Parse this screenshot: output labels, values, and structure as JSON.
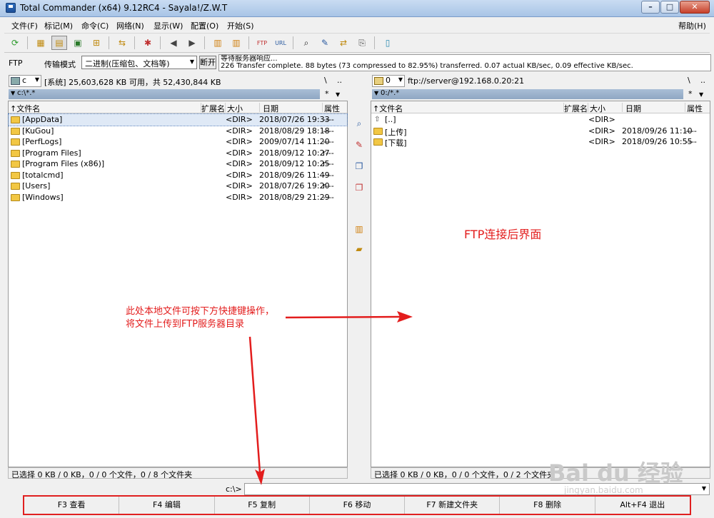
{
  "window": {
    "title": "Total Commander (x64) 9.12RC4 - Sayala!/Z.W.T",
    "controls": [
      "–",
      "□",
      "✕"
    ]
  },
  "menu": {
    "items": [
      "文件(F)",
      "标记(M)",
      "命令(C)",
      "网络(N)",
      "显示(W)",
      "配置(O)",
      "开始(S)"
    ],
    "help": "帮助(H)"
  },
  "ftpbar": {
    "label": "FTP",
    "mode_label": "传输模式",
    "mode_value": "二进制(压缩包、文档等)",
    "disconnect": "断开",
    "log_line1": "等待服务器响应...",
    "log_line2": "226 Transfer complete. 88 bytes (73 compressed to 82.95%) transferred. 0.07 actual KB/sec, 0.09 effective KB/sec."
  },
  "left": {
    "drive": "c",
    "info": "[系统]  25,603,628 KB 可用，共 52,430,844 KB",
    "path": "c:\\*.*",
    "columns": {
      "name": "文件名",
      "ext": "扩展名",
      "size": "大小",
      "date": "日期",
      "attr": "属性"
    },
    "files": [
      {
        "name": "[AppData]",
        "size": "<DIR>",
        "date": "2018/07/26 19:33",
        "attr": "----"
      },
      {
        "name": "[KuGou]",
        "size": "<DIR>",
        "date": "2018/08/29 18:18",
        "attr": "----"
      },
      {
        "name": "[PerfLogs]",
        "size": "<DIR>",
        "date": "2009/07/14 11:20",
        "attr": "----"
      },
      {
        "name": "[Program Files]",
        "size": "<DIR>",
        "date": "2018/09/12 10:27",
        "attr": "r---"
      },
      {
        "name": "[Program Files (x86)]",
        "size": "<DIR>",
        "date": "2018/09/12 10:25",
        "attr": "r---"
      },
      {
        "name": "[totalcmd]",
        "size": "<DIR>",
        "date": "2018/09/26 11:49",
        "attr": "----"
      },
      {
        "name": "[Users]",
        "size": "<DIR>",
        "date": "2018/07/26 19:20",
        "attr": "r---"
      },
      {
        "name": "[Windows]",
        "size": "<DIR>",
        "date": "2018/08/29 21:29",
        "attr": "----"
      }
    ],
    "status": "已选择 0 KB / 0 KB，0 / 0 个文件，0 / 8 个文件夹"
  },
  "right": {
    "drive": "0",
    "info": "ftp://server@192.168.0.20:21",
    "path": "0:/*.*",
    "columns": {
      "name": "文件名",
      "ext": "扩展名",
      "size": "大小",
      "date": "日期",
      "attr": "属性"
    },
    "files": [
      {
        "name": "[..]",
        "size": "<DIR>",
        "date": "",
        "attr": ""
      },
      {
        "name": "[上传]",
        "size": "<DIR>",
        "date": "2018/09/26 11:10",
        "attr": "----"
      },
      {
        "name": "[下载]",
        "size": "<DIR>",
        "date": "2018/09/26 10:55",
        "attr": "----"
      }
    ],
    "status": "已选择 0 KB / 0 KB，0 / 0 个文件，0 / 2 个文件夹"
  },
  "panel_nav": {
    "root": "\\",
    "parent": "..",
    "filter": "*"
  },
  "cmdline": {
    "label": "c:\\>"
  },
  "fkeys": [
    "F3 查看",
    "F4 编辑",
    "F5 复制",
    "F6 移动",
    "F7 新建文件夹",
    "F8 删除",
    "Alt+F4 退出"
  ],
  "annotations": {
    "ftp_title": "FTP连接后界面",
    "note_line1": "此处本地文件可按下方快捷键操作，",
    "note_line2": "将文件上传到FTP服务器目录"
  },
  "watermark": {
    "main": "Bai du 经验",
    "sub": "jingyan.baidu.com"
  },
  "colors": {
    "annotation": "#e31d1d",
    "fkey_border": "#e02020",
    "path_bar": "#a9bed6",
    "folder": "#f2c744"
  }
}
